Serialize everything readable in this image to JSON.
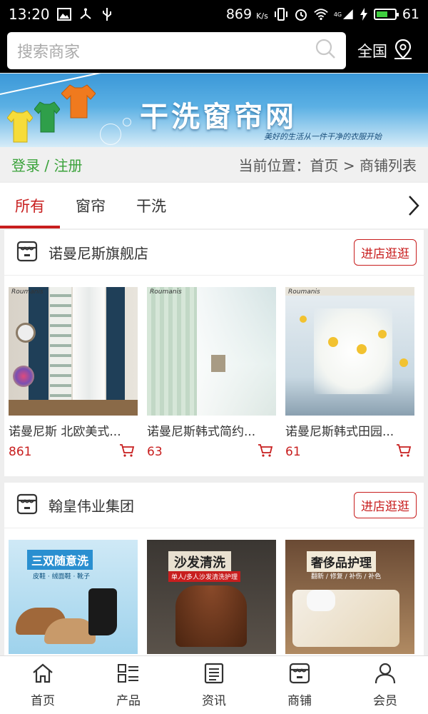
{
  "status_bar": {
    "time": "13:20",
    "net_speed": "869",
    "net_unit": "K/s",
    "signal_label": "4G",
    "battery": "61",
    "battery_level": 0.61
  },
  "search": {
    "placeholder": "搜索商家",
    "region": "全国"
  },
  "banner": {
    "title": "干洗窗帘网",
    "slogan": "美好的生活从一件干净的衣服开始"
  },
  "breadcrumb": {
    "login": "登录 / 注册",
    "location": "当前位置：首页 > 商铺列表"
  },
  "tabs": [
    {
      "label": "所有",
      "active": true
    },
    {
      "label": "窗帘",
      "active": false
    },
    {
      "label": "干洗",
      "active": false
    }
  ],
  "shops": [
    {
      "name": "诺曼尼斯旗舰店",
      "enter_label": "进店逛逛",
      "products": [
        {
          "name": "诺曼尼斯 北欧美式...",
          "price": "861",
          "brand": "Roumanis"
        },
        {
          "name": "诺曼尼斯韩式简约...",
          "price": "63",
          "brand": "Roumanis"
        },
        {
          "name": "诺曼尼斯韩式田园...",
          "price": "61",
          "brand": "Roumanis"
        }
      ]
    },
    {
      "name": "翰皇伟业集团",
      "enter_label": "进店逛逛",
      "products": [
        {
          "title": "三双随意洗",
          "subtitle": "皮鞋 · 绒面鞋 · 靴子"
        },
        {
          "title": "沙发清洗",
          "subtitle": "单人/多人沙发清洗护理"
        },
        {
          "title": "奢侈品护理",
          "subtitle": "翻新 / 修复 / 补伤 / 补色"
        }
      ]
    }
  ],
  "bottom_nav": [
    {
      "label": "首页",
      "icon": "home-icon"
    },
    {
      "label": "产品",
      "icon": "list-icon"
    },
    {
      "label": "资讯",
      "icon": "news-icon"
    },
    {
      "label": "商铺",
      "icon": "shop-icon"
    },
    {
      "label": "会员",
      "icon": "user-icon"
    }
  ],
  "colors": {
    "accent": "#c81e1e",
    "login_green": "#3aa23a",
    "banner_blue": "#3b98d8"
  }
}
